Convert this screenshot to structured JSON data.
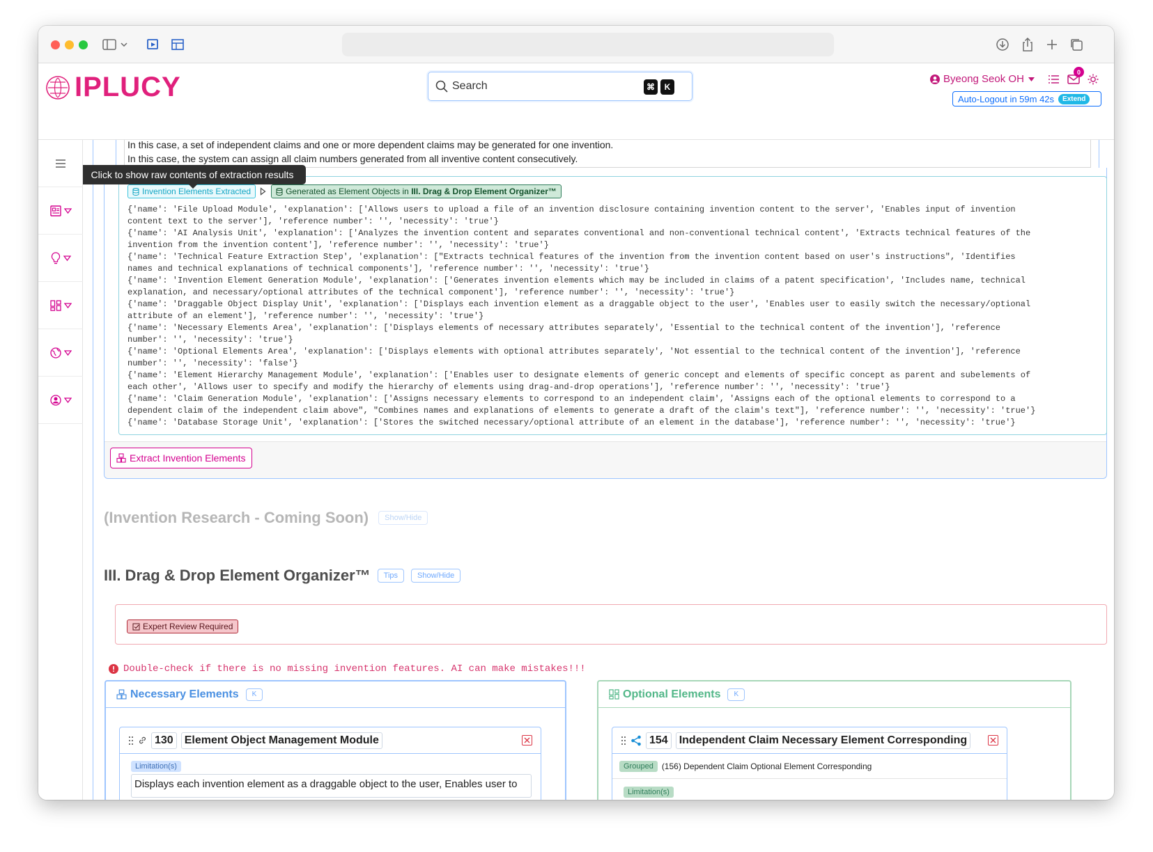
{
  "app": {
    "logo_text": "IPLUCY"
  },
  "search": {
    "placeholder": "Search",
    "shortcut_cmd": "⌘",
    "shortcut_key": "K"
  },
  "user": {
    "name": "Byeong Seok OH",
    "notification_count": "0",
    "auto_logout": "Auto-Logout in 59m 42s",
    "extend_label": "Extend"
  },
  "top_text": {
    "line1": "In this case, a set of independent claims and one or more dependent claims may be generated for one invention.",
    "line2": "In this case, the system can assign all claim numbers generated from all inventive content consecutively."
  },
  "tooltip": "Click to show raw contents of extraction results",
  "badges": {
    "extracted": "Invention Elements Extracted",
    "generated_prefix": "Generated as Element Objects in ",
    "generated_bold": "III. Drag & Drop Element Organizer™"
  },
  "raw_lines": [
    "{'name': 'File Upload Module', 'explanation': ['Allows users to upload a file of an invention disclosure containing invention content to the server', 'Enables input of invention",
    "content text to the server'], 'reference number': '', 'necessity': 'true'}",
    "{'name': 'AI Analysis Unit', 'explanation': ['Analyzes the invention content and separates conventional and non-conventional technical content', 'Extracts technical features of the",
    "invention from the invention content'], 'reference number': '', 'necessity': 'true'}",
    "{'name': 'Technical Feature Extraction Step', 'explanation': [\"Extracts technical features of the invention from the invention content based on user's instructions\", 'Identifies",
    "names and technical explanations of technical components'], 'reference number': '', 'necessity': 'true'}",
    "{'name': 'Invention Element Generation Module', 'explanation': ['Generates invention elements which may be included in claims of a patent specification', 'Includes name, technical",
    "explanation, and necessary/optional attributes of the technical component'], 'reference number': '', 'necessity': 'true'}",
    "{'name': 'Draggable Object Display Unit', 'explanation': ['Displays each invention element as a draggable object to the user', 'Enables user to easily switch the necessary/optional",
    "attribute of an element'], 'reference number': '', 'necessity': 'true'}",
    "{'name': 'Necessary Elements Area', 'explanation': ['Displays elements of necessary attributes separately', 'Essential to the technical content of the invention'], 'reference",
    "number': '', 'necessity': 'true'}",
    "{'name': 'Optional Elements Area', 'explanation': ['Displays elements with optional attributes separately', 'Not essential to the technical content of the invention'], 'reference",
    "number': '', 'necessity': 'false'}",
    "{'name': 'Element Hierarchy Management Module', 'explanation': ['Enables user to designate elements of generic concept and elements of specific concept as parent and subelements of",
    "each other', 'Allows user to specify and modify the hierarchy of elements using drag-and-drop operations'], 'reference number': '', 'necessity': 'true'}",
    "{'name': 'Claim Generation Module', 'explanation': ['Assigns necessary elements to correspond to an independent claim', 'Assigns each of the optional elements to correspond to a",
    "dependent claim of the independent claim above\", \"Combines names and explanations of elements to generate a draft of the claim's text\"], 'reference number': '', 'necessity': 'true'}",
    "{'name': 'Database Storage Unit', 'explanation': ['Stores the switched necessary/optional attribute of an element in the database'], 'reference number': '', 'necessity': 'true'}"
  ],
  "extract_button": "Extract Invention Elements",
  "research": {
    "title": "(Invention Research - Coming Soon)",
    "toggle": "Show/Hide"
  },
  "organizer": {
    "title": "III. Drag & Drop Element Organizer™",
    "tips": "Tips",
    "toggle": "Show/Hide",
    "review_badge": "Expert Review Required"
  },
  "warning": "Double-check if there is no missing invention features. AI can make mistakes!!!",
  "necessary": {
    "title": "Necessary Elements",
    "collapse": "K",
    "element": {
      "number": "130",
      "name": "Element Object Management Module",
      "limitation_label": "Limitation(s)",
      "limitation_text": "Displays each invention element as a draggable object to the user, Enables user to"
    }
  },
  "optional": {
    "title": "Optional Elements",
    "collapse": "K",
    "element": {
      "number": "154",
      "name": "Independent Claim Necessary Element Corresponding",
      "grouped_label": "Grouped",
      "grouped_text": "(156) Dependent Claim Optional Element Corresponding",
      "limitation_label": "Limitation(s)"
    }
  },
  "colors": {
    "brand": "#e0207c",
    "necessary": "#4a90e2",
    "optional": "#52b788",
    "danger": "#dc3545"
  }
}
